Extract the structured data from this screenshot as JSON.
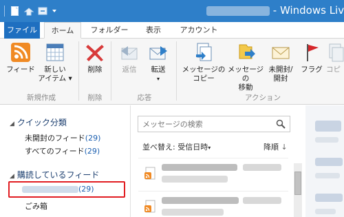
{
  "window": {
    "title_suffix": "- Windows Liv"
  },
  "tabs": [
    {
      "label": "ファイル"
    },
    {
      "label": "ホーム"
    },
    {
      "label": "フォルダー"
    },
    {
      "label": "表示"
    },
    {
      "label": "アカウント"
    }
  ],
  "ribbon": {
    "feed": {
      "label": "フィード"
    },
    "new_item": {
      "label_line1": "新しい",
      "label_line2": "アイテム ▾"
    },
    "group_new": "新規作成",
    "delete": {
      "label": "削除"
    },
    "group_delete": "削除",
    "reply": {
      "label": "返信"
    },
    "forward": {
      "label": "転送",
      "arrow": "▾"
    },
    "group_respond": "応答",
    "copy_msg": {
      "label_line1": "メッセージの",
      "label_line2": "コピー"
    },
    "move_msg": {
      "label_line1": "メッセージの",
      "label_line2": "移動"
    },
    "unread_read": {
      "label_line1": "未開封/",
      "label_line2": "開封"
    },
    "flag": {
      "label": "フラグ"
    },
    "copy_partial": {
      "label": "コピ"
    },
    "group_actions": "アクション"
  },
  "left_pane": {
    "quick_views": "クイック分類",
    "unread_feeds": {
      "label": "未開封のフィード",
      "count": "(29)"
    },
    "all_feeds": {
      "label": "すべてのフィード",
      "count": "(29)"
    },
    "subscribed": "購読しているフィード",
    "feed_item": {
      "count": "(29)"
    },
    "trash": "ごみ箱"
  },
  "message_list": {
    "search_placeholder": "メッセージの検索",
    "sort_label": "並べ替え: 受信日時",
    "sort_arrow": "▾",
    "order_label": "降順",
    "order_arrow": "↓"
  },
  "colors": {
    "title_bar": "#2e7fc9",
    "file_tab": "#1e6fc0",
    "highlight": "#e11d22",
    "accent": "#1b5fb0"
  }
}
